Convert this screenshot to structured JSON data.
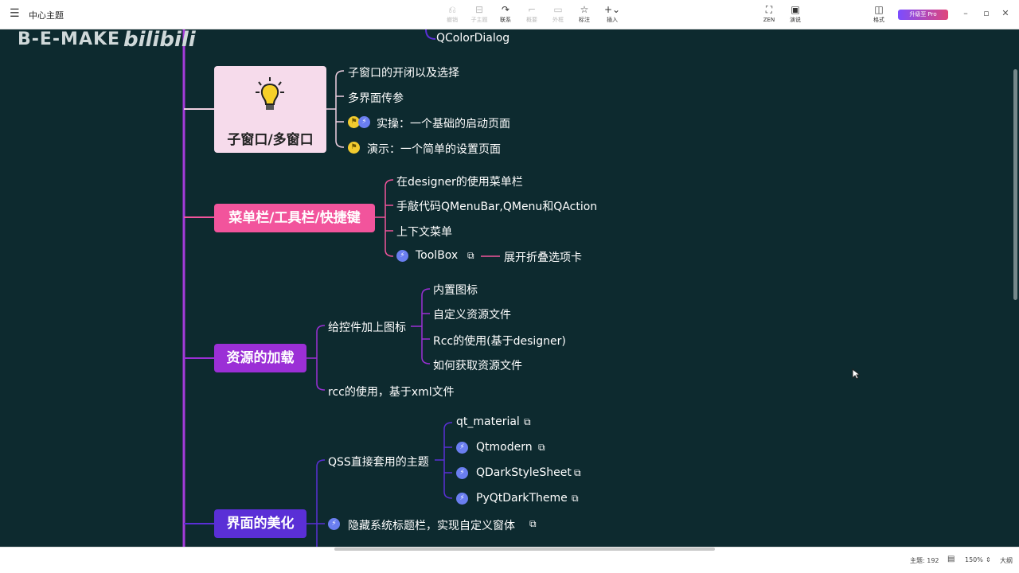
{
  "app": {
    "title": "中心主题",
    "toolbar": [
      {
        "label": "撤销",
        "icon": "undo-icon",
        "glyph": "⎌"
      },
      {
        "label": "子主题",
        "icon": "subtopic-icon",
        "glyph": "⊟"
      },
      {
        "label": "联系",
        "icon": "relation-icon",
        "glyph": "↷"
      },
      {
        "label": "概要",
        "icon": "summary-icon",
        "glyph": "⌐"
      },
      {
        "label": "外框",
        "icon": "boundary-icon",
        "glyph": "▭"
      },
      {
        "label": "标注",
        "icon": "star-icon",
        "glyph": "☆"
      },
      {
        "label": "插入",
        "icon": "plus-icon",
        "glyph": "+⌄"
      }
    ],
    "right_tools": [
      {
        "label": "ZEN",
        "icon": "fullscreen-icon",
        "glyph": "⛶"
      },
      {
        "label": "演说",
        "icon": "present-icon",
        "glyph": "▣"
      },
      {
        "label": "格式",
        "icon": "format-icon",
        "glyph": "◫"
      }
    ],
    "upgrade_label": "升级至 Pro",
    "window_controls": [
      "–",
      "▫",
      "✕"
    ]
  },
  "watermark": {
    "text": "B-E-MAKE",
    "logo": "bilibili"
  },
  "mindmap": {
    "top_item": "QColorDialog",
    "branches": [
      {
        "title": "子窗口/多窗口",
        "color": "#f6dbeb",
        "children": [
          "子窗口的开闭以及选择",
          "多界面传参",
          "实操：一个基础的启动页面",
          "演示：一个简单的设置页面"
        ]
      },
      {
        "title": "菜单栏/工具栏/快捷键",
        "color": "#f2549c",
        "children": [
          "在designer的使用菜单栏",
          "手敲代码QMenuBar,QMenu和QAction",
          "上下文菜单",
          "ToolBox"
        ],
        "toolbox_child": "展开折叠选项卡"
      },
      {
        "title": "资源的加载",
        "color": "#9b2fd6",
        "sub": "给控件加上图标",
        "sub_children": [
          "内置图标",
          "自定义资源文件",
          "Rcc的使用(基于designer)",
          "如何获取资源文件"
        ],
        "child2": "rcc的使用，基于xml文件"
      },
      {
        "title": "界面的美化",
        "color": "#5a2fd6",
        "sub": "QSS直接套用的主题",
        "sub_children": [
          "qt_material",
          "Qtmodern",
          "QDarkStyleSheet",
          "PyQtDarkTheme"
        ],
        "child2": "隐藏系统标题栏，实现自定义窗体"
      }
    ]
  },
  "status": {
    "topics": "主题: 192",
    "zoom": "150%",
    "outline": "大纲"
  }
}
